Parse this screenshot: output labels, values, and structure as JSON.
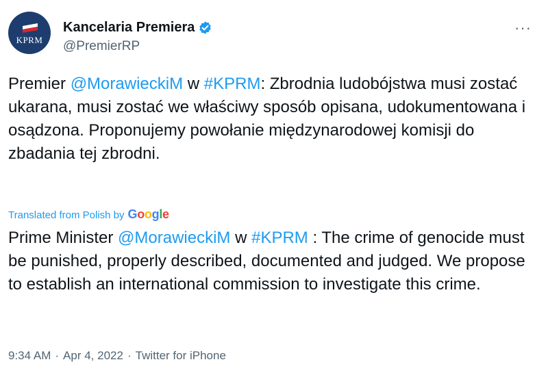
{
  "account": {
    "avatar_text": "KPRM",
    "display_name": "Kancelaria Premiera",
    "handle": "@PremierRP",
    "verified_icon": "verified-badge-icon",
    "more_icon": "more-options-icon",
    "more_label": "···"
  },
  "tweet": {
    "original": {
      "p1": "Premier ",
      "mention": "@MorawieckiM",
      "p2": " w ",
      "hashtag": "#KPRM",
      "p3": ": Zbrodnia ludobójstwa musi zostać ukarana, musi zostać we właściwy sposób opisana, udokumentowana i osądzona. Proponujemy powołanie międzynarodowej komisji do zbadania tej zbrodni."
    },
    "translation_note": "Translated from Polish by",
    "translation_provider": "Google",
    "translation": {
      "p1": "Prime Minister ",
      "mention": "@MorawieckiM",
      "p2": " w ",
      "hashtag": "#KPRM",
      "p3": " : The crime of genocide must be punished, properly described, documented and judged. We propose to establish an international commission to investigate this crime."
    }
  },
  "meta": {
    "time": "9:34 AM",
    "date": "Apr 4, 2022",
    "source": "Twitter for iPhone",
    "separator": "·"
  },
  "colors": {
    "link": "#1d9bf0",
    "text": "#0f1419",
    "secondary": "#536471",
    "avatar_bg": "#1d3d6e"
  }
}
